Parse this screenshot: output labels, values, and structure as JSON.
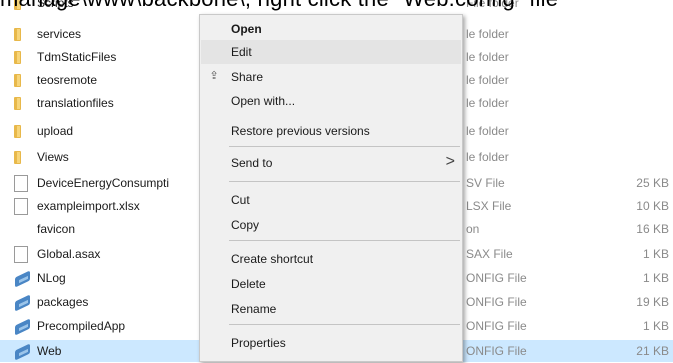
{
  "banner": {
    "text": "manage\\www\\backbone\\, right click the \"Web.config\" file"
  },
  "files": [
    {
      "name": "Scripts",
      "icon": "folder-icon",
      "type": "File folder",
      "size": ""
    },
    {
      "name": "services",
      "icon": "folder-icon",
      "type": "le folder",
      "size": ""
    },
    {
      "name": "TdmStaticFiles",
      "icon": "folder-icon",
      "type": "le folder",
      "size": ""
    },
    {
      "name": "teosremote",
      "icon": "folder-icon",
      "type": "le folder",
      "size": ""
    },
    {
      "name": "translationfiles",
      "icon": "folder-icon",
      "type": "le folder",
      "size": ""
    },
    {
      "name": "upload",
      "icon": "folder-icon",
      "type": "le folder",
      "size": ""
    },
    {
      "name": "Views",
      "icon": "folder-icon",
      "type": "le folder",
      "size": ""
    },
    {
      "name": "DeviceEnergyConsumpti",
      "icon": "file-icon",
      "type": "SV File",
      "size": "25 KB"
    },
    {
      "name": "exampleimport.xlsx",
      "icon": "file-icon",
      "type": "LSX File",
      "size": "10 KB"
    },
    {
      "name": "favicon",
      "icon": "none",
      "type": "on",
      "size": "16 KB"
    },
    {
      "name": "Global.asax",
      "icon": "file-icon",
      "type": "SAX File",
      "size": "1 KB"
    },
    {
      "name": "NLog",
      "icon": "config-file-icon",
      "type": "ONFIG File",
      "size": "1 KB"
    },
    {
      "name": "packages",
      "icon": "config-file-icon",
      "type": "ONFIG File",
      "size": "19 KB"
    },
    {
      "name": "PrecompiledApp",
      "icon": "config-file-icon",
      "type": "ONFIG File",
      "size": "1 KB"
    },
    {
      "name": "Web",
      "icon": "config-file-icon",
      "type": "ONFIG File",
      "size": "21 KB",
      "selected": true
    }
  ],
  "context_menu": {
    "open": "Open",
    "edit": "Edit",
    "share": "Share",
    "open_with": "Open with...",
    "restore": "Restore previous versions",
    "send_to": "Send to",
    "send_to_arrow": ">",
    "cut": "Cut",
    "copy": "Copy",
    "create_shortcut": "Create shortcut",
    "delete": "Delete",
    "rename": "Rename",
    "properties": "Properties"
  },
  "colors": {
    "selection": "#cce8ff",
    "menu_bg": "#f0f0f0",
    "hover": "#e4e4e4"
  }
}
